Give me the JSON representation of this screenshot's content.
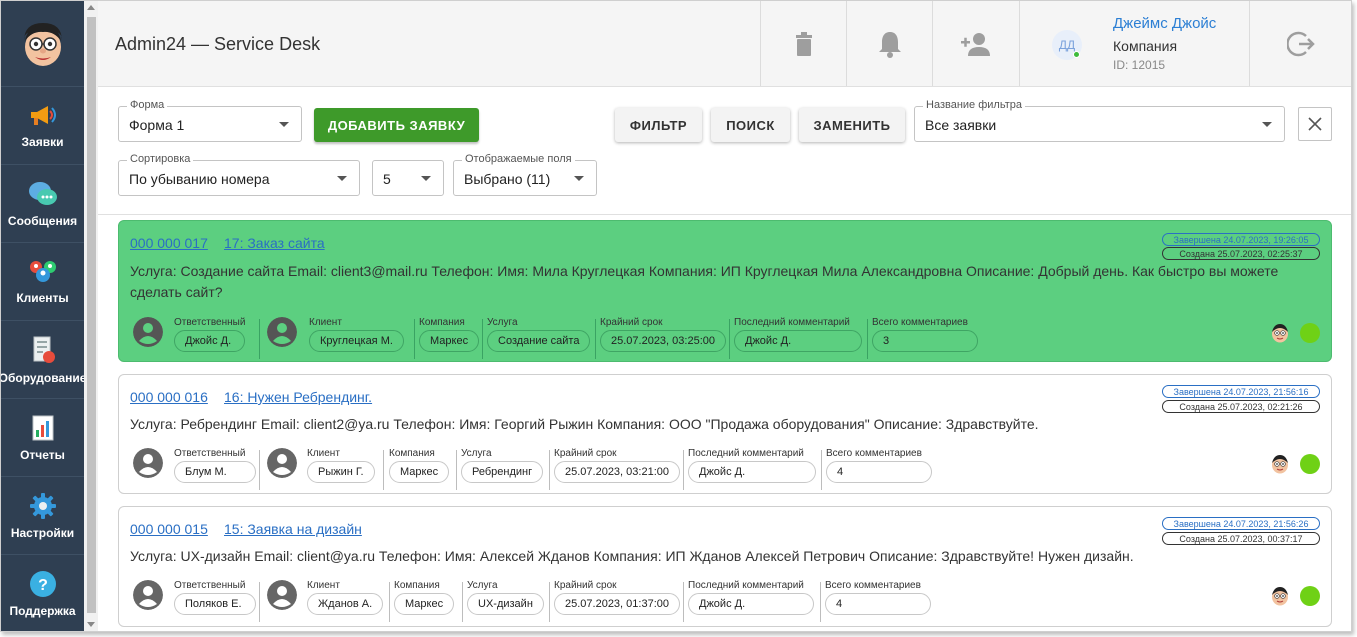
{
  "app": {
    "title": "Admin24 — Service Desk"
  },
  "sidebar": {
    "items": [
      {
        "label": "Заявки",
        "icon": "megaphone-icon"
      },
      {
        "label": "Сообщения",
        "icon": "chat-bubbles-icon"
      },
      {
        "label": "Клиенты",
        "icon": "clients-icon"
      },
      {
        "label": "Оборудование",
        "icon": "equipment-icon"
      },
      {
        "label": "Отчеты",
        "icon": "report-icon"
      },
      {
        "label": "Настройки",
        "icon": "gear-icon"
      },
      {
        "label": "Поддержка",
        "icon": "help-icon"
      }
    ]
  },
  "header": {
    "actions": [
      "trash-icon",
      "bell-icon",
      "add-user-icon",
      "logout-icon"
    ],
    "user": {
      "initials": "ДД",
      "name": "Джеймс Джойс",
      "company": "Компания",
      "id": "ID: 12015"
    }
  },
  "toolbar": {
    "form": {
      "label": "Форма",
      "value": "Форма 1"
    },
    "add_button": "ДОБАВИТЬ ЗАЯВКУ",
    "filter_button": "ФИЛЬТР",
    "search_button": "ПОИСК",
    "replace_button": "ЗАМЕНИТЬ",
    "filter_name": {
      "label": "Название фильтра",
      "value": "Все заявки"
    },
    "sort": {
      "label": "Сортировка",
      "value": "По убыванию номера"
    },
    "per_page": {
      "value": "5"
    },
    "fields": {
      "label": "Отображаемые поля",
      "value": "Выбрано (11)"
    }
  },
  "meta_labels": {
    "responsible": "Ответственный",
    "client": "Клиент",
    "company": "Компания",
    "service": "Услуга",
    "deadline": "Крайний срок",
    "last_comment": "Последний комментарий",
    "total_comments": "Всего комментариев"
  },
  "colors": {
    "sidebar": "#2f3f52",
    "accent_green": "#3e9a2a",
    "done_card": "#5ccf80",
    "link": "#2a6fc4",
    "status_dot": "#6fd116"
  },
  "tickets": [
    {
      "number": "000 000 017",
      "subject": "17: Заказ сайта",
      "completed": "Завершена 24.07.2023, 19:26:05",
      "created": "Создана 25.07.2023, 02:25:37",
      "description": "Услуга: Создание сайта Email: client3@mail.ru Телефон: Имя: Мила Круглецкая Компания: ИП Круглецкая Мила Александровна Описание: Добрый день. Как быстро вы можете сделать сайт?",
      "responsible": "Джойс Д.",
      "client": "Круглецкая М.",
      "company": "Маркес",
      "service": "Создание сайта",
      "deadline": "25.07.2023, 03:25:00",
      "last_comment": "Джойс Д.",
      "total_comments": "3"
    },
    {
      "number": "000 000 016",
      "subject": "16: Нужен Ребрендинг.",
      "completed": "Завершена 24.07.2023, 21:56:16",
      "created": "Создана 25.07.2023, 02:21:26",
      "description": "Услуга: Ребрендинг Email: client2@ya.ru Телефон: Имя: Георгий Рыжин Компания: ООО \"Продажа оборудования\" Описание: Здравствуйте.",
      "responsible": "Блум М.",
      "client": "Рыжин Г.",
      "company": "Маркес",
      "service": "Ребрендинг",
      "deadline": "25.07.2023, 03:21:00",
      "last_comment": "Джойс Д.",
      "total_comments": "4"
    },
    {
      "number": "000 000 015",
      "subject": "15: Заявка на дизайн",
      "completed": "Завершена 24.07.2023, 21:56:26",
      "created": "Создана 25.07.2023, 00:37:17",
      "description": "Услуга: UX-дизайн Email: client@ya.ru Телефон: Имя: Алексей Жданов Компания: ИП Жданов Алексей Петрович Описание: Здравствуйте! Нужен дизайн.",
      "responsible": "Поляков Е.",
      "client": "Жданов А.",
      "company": "Маркес",
      "service": "UX-дизайн",
      "deadline": "25.07.2023, 01:37:00",
      "last_comment": "Джойс Д.",
      "total_comments": "4"
    }
  ]
}
